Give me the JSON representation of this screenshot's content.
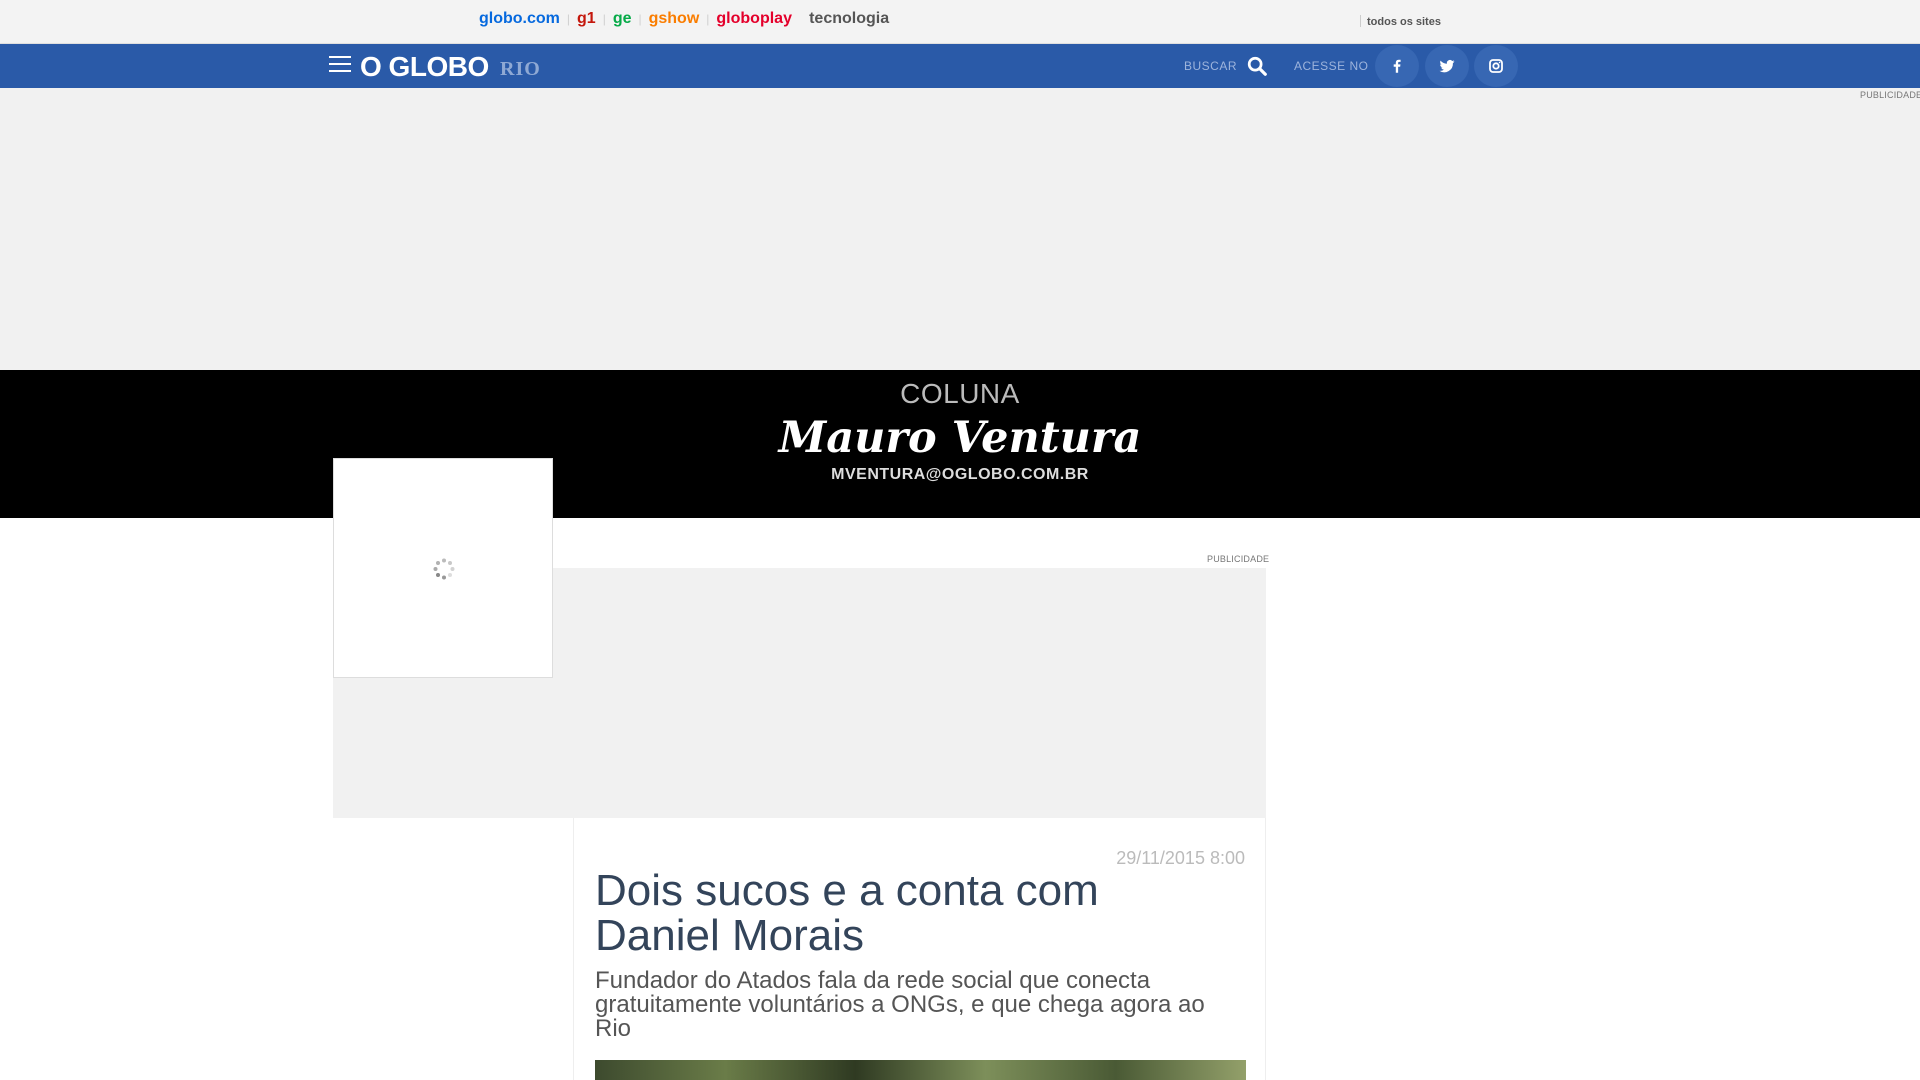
{
  "globobar": {
    "links": [
      {
        "label": "globo.com",
        "color": "#0669de"
      },
      {
        "label": "g1",
        "color": "#c4170c"
      },
      {
        "label": "ge",
        "color": "#06aa48"
      },
      {
        "label": "gshow",
        "color": "#fa7d00"
      },
      {
        "label": "globoplay",
        "color": "#e4002b"
      },
      {
        "label": "tecnologia",
        "color": "#555555"
      }
    ],
    "all_sites": "todos os sites"
  },
  "header": {
    "brand": "O GLOBO",
    "section": "RIO",
    "search_label": "BUSCAR",
    "access_label": "ACESSE NO",
    "social": [
      "facebook-icon",
      "twitter-icon",
      "instagram-icon"
    ]
  },
  "ads": {
    "top_label": "PUBLICIDADE",
    "mid_label": "PUBLICIDADE"
  },
  "column": {
    "tag": "COLUNA",
    "author": "Mauro Ventura",
    "email": "MVENTURA@OGLOBO.COM.BR"
  },
  "article": {
    "date": "29/11/2015 8:00",
    "title": "Dois sucos e a conta com Daniel Morais",
    "subtitle": "Fundador do Atados fala da rede social que conecta gratuitamente voluntários a ONGs, e que chega agora ao Rio"
  },
  "colors": {
    "header_blue": "#2a5aa8",
    "banner_black": "#000000",
    "title_text": "#33445a"
  }
}
